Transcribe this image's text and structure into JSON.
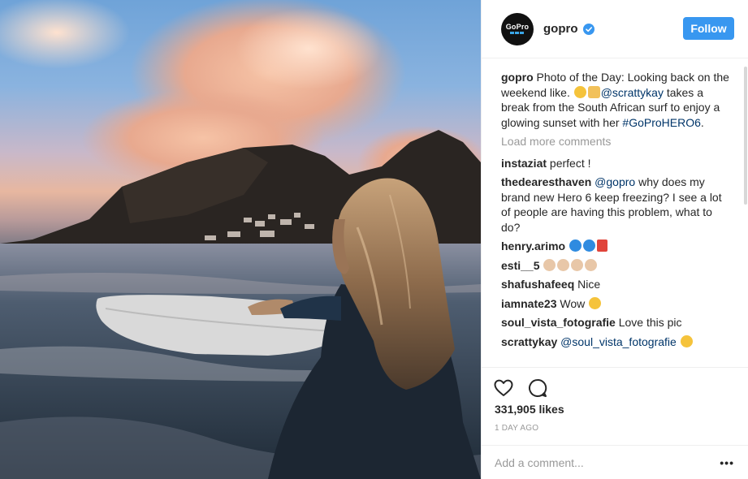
{
  "post": {
    "username": "gopro",
    "avatar_text": "GoPro",
    "follow_label": "Follow",
    "caption": {
      "user": "gopro",
      "text_1": "Photo of the Day: Looking back on the weekend like. ",
      "mention": "@scrattykay",
      "text_2": " takes a break from the South African surf to enjoy a glowing sunset with her ",
      "hashtag": "#GoProHERO6",
      "text_3": "."
    },
    "load_more": "Load more comments",
    "comments": [
      {
        "user": "instaziat",
        "text": "perfect !"
      },
      {
        "user": "thedearesthaven",
        "mention": "@gopro",
        "text": " why does my brand new Hero 6 keep freezing? I see a lot of people are having this problem, what to do?"
      },
      {
        "user": "henry.arimo",
        "text": ""
      },
      {
        "user": "esti__5",
        "text": ""
      },
      {
        "user": "shafushafeeq",
        "text": "Nice"
      },
      {
        "user": "iamnate23",
        "text": "Wow"
      },
      {
        "user": "soul_vista_fotografie",
        "text": "Love this pic"
      },
      {
        "user": "scrattykay",
        "mention": "@soul_vista_fotografie",
        "text": " "
      }
    ],
    "likes": "331,905 likes",
    "time": "1 DAY AGO",
    "add_comment_placeholder": "Add a comment...",
    "more_label": "•••"
  },
  "icons": [
    "verified-badge-icon",
    "heart-icon",
    "comment-icon",
    "more-options-icon"
  ],
  "colors": {
    "accent": "#3897f0",
    "link": "#003569",
    "muted": "#999999"
  }
}
